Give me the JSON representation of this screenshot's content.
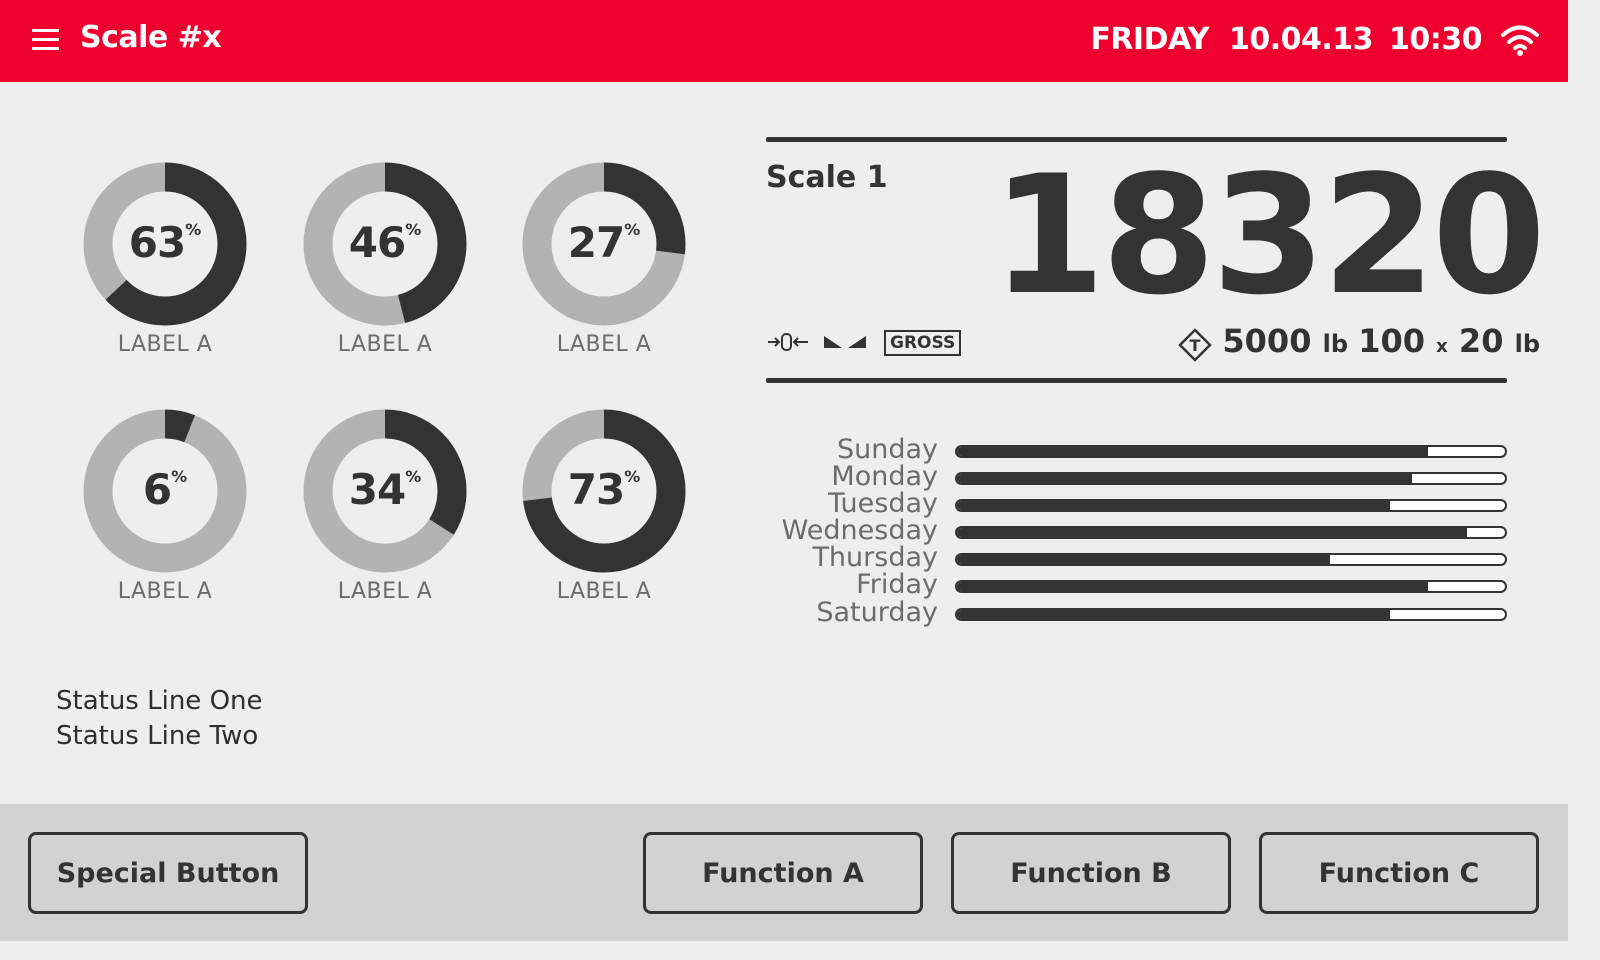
{
  "header": {
    "title": "Scale #x",
    "day": "FRIDAY",
    "date": "10.04.13",
    "time": "10:30"
  },
  "donuts": [
    {
      "value": 63,
      "percent_sign": "%",
      "label": "LABEL A"
    },
    {
      "value": 46,
      "percent_sign": "%",
      "label": "LABEL A"
    },
    {
      "value": 27,
      "percent_sign": "%",
      "label": "LABEL A"
    },
    {
      "value": 6,
      "percent_sign": "%",
      "label": "LABEL A"
    },
    {
      "value": 34,
      "percent_sign": "%",
      "label": "LABEL A"
    },
    {
      "value": 73,
      "percent_sign": "%",
      "label": "LABEL A"
    }
  ],
  "status": {
    "line1": "Status Line One",
    "line2": "Status Line Two"
  },
  "scale": {
    "name": "Scale 1",
    "weight": "18320",
    "gross_label": "GROSS",
    "capacity_value": "5000",
    "capacity_unit": "lb",
    "division_count": "100",
    "division_x": "x",
    "division_value": "20",
    "division_unit": "lb"
  },
  "weekly": [
    {
      "day": "Sunday",
      "fill": 0.86
    },
    {
      "day": "Monday",
      "fill": 0.83
    },
    {
      "day": "Tuesday",
      "fill": 0.79
    },
    {
      "day": "Wednesday",
      "fill": 0.93
    },
    {
      "day": "Thursday",
      "fill": 0.68
    },
    {
      "day": "Friday",
      "fill": 0.86
    },
    {
      "day": "Saturday",
      "fill": 0.79
    }
  ],
  "footer": {
    "special": "Special Button",
    "function_a": "Function A",
    "function_b": "Function B",
    "function_c": "Function C"
  },
  "colors": {
    "brand": "#f0002e",
    "dark": "#333333",
    "track": "#b3b3b3"
  }
}
